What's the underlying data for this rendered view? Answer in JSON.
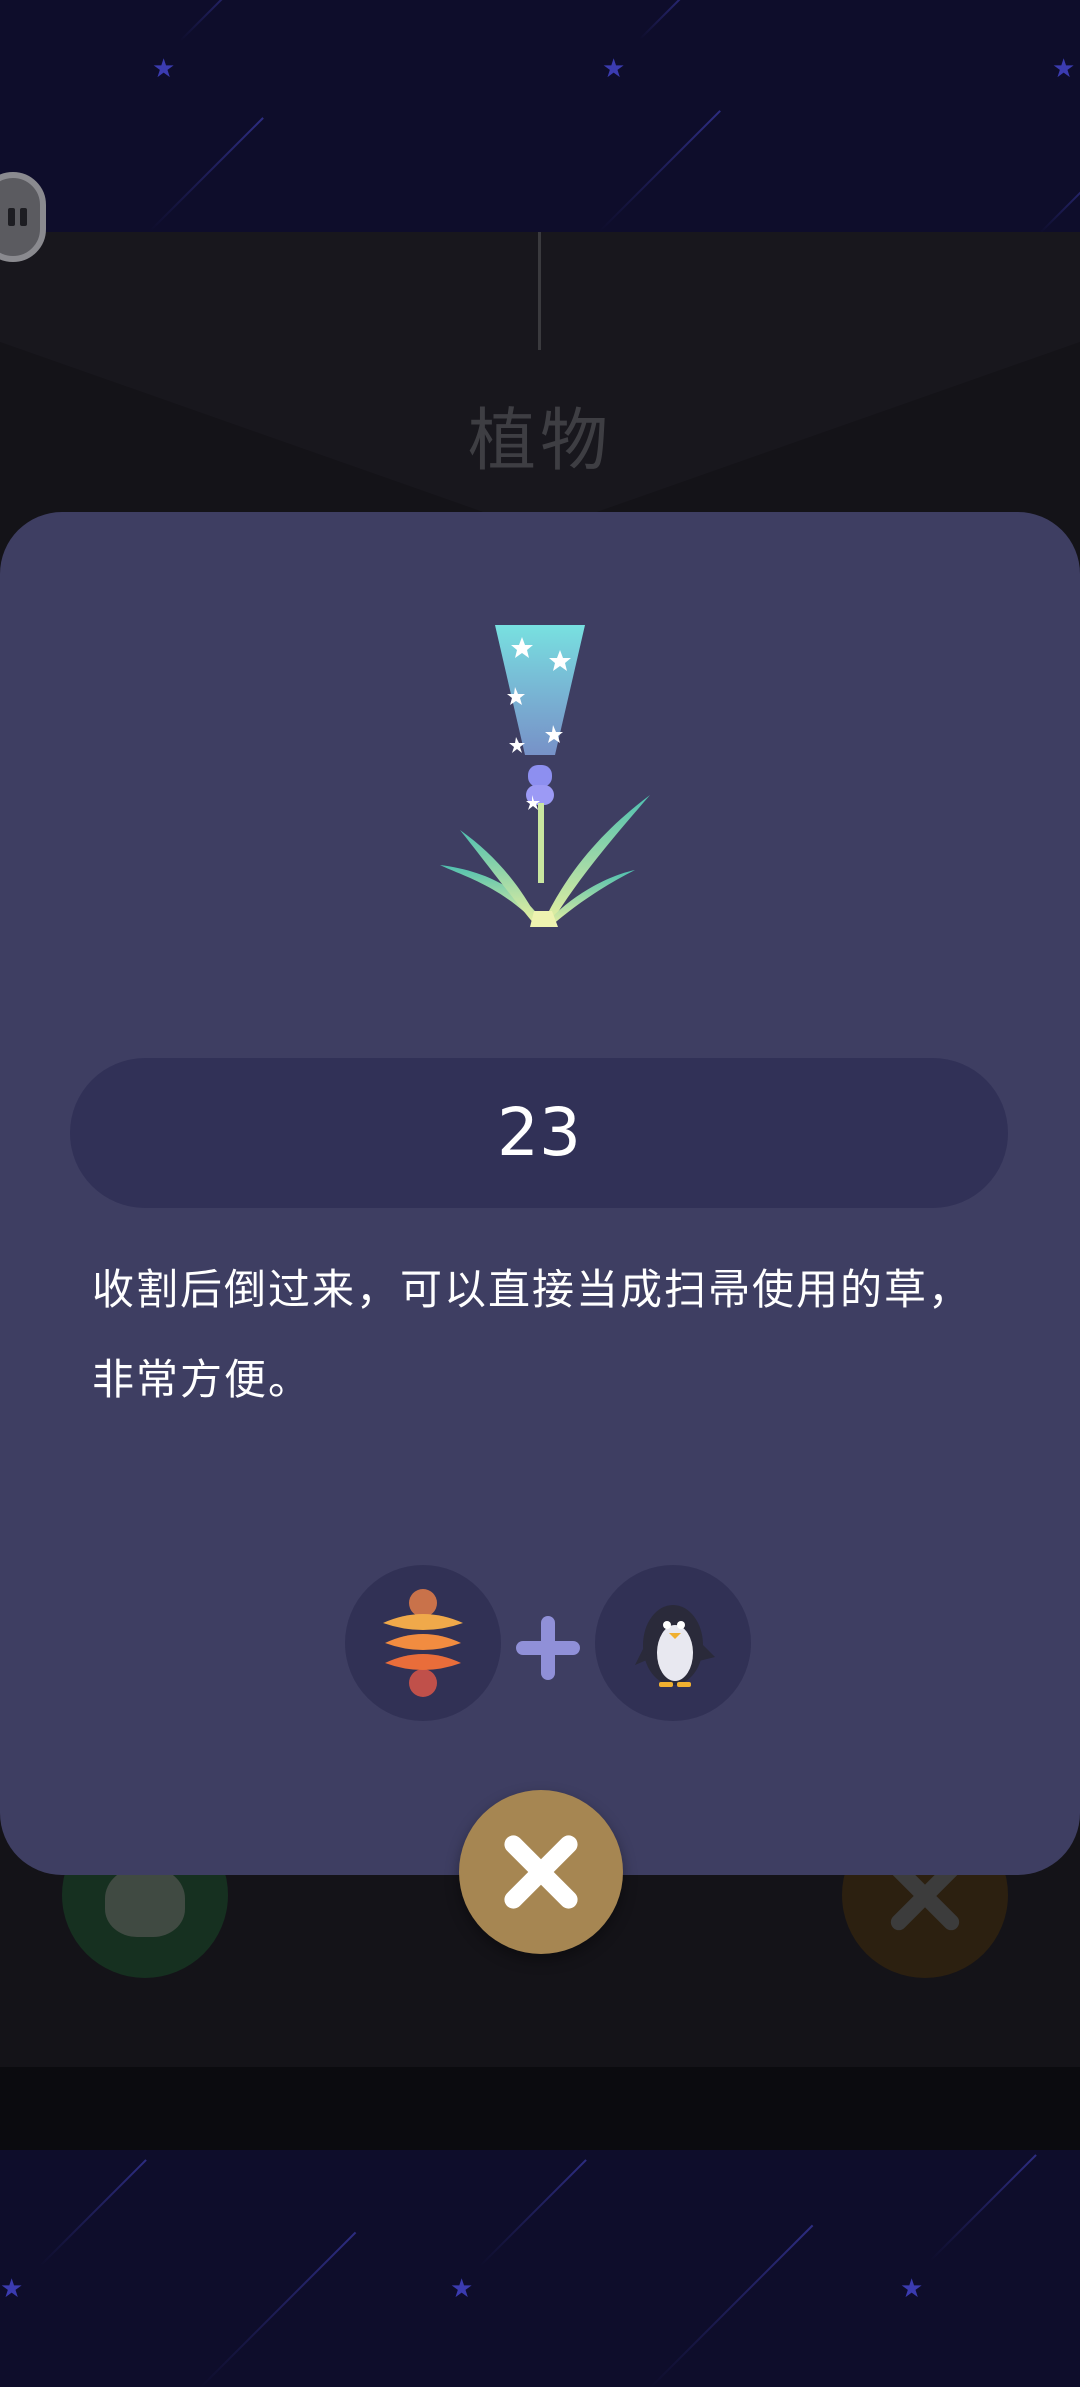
{
  "background": {
    "section_title": "植物"
  },
  "detail": {
    "item_icon": "broom-grass-icon",
    "count": "23",
    "description": "收割后倒过来，可以直接当成扫帚使用的草，非常方便。",
    "recipe": {
      "ingredients": [
        {
          "icon": "orange-lantern-icon"
        },
        {
          "icon": "penguin-icon"
        }
      ],
      "operator_icon": "plus-icon"
    }
  },
  "buttons": {
    "close_icon": "close-icon",
    "pause_icon": "pause-icon"
  },
  "colors": {
    "card": "#3e3e62",
    "pill": "#313157",
    "close_button": "#a68652",
    "night_sky": "#0e0d2b"
  }
}
